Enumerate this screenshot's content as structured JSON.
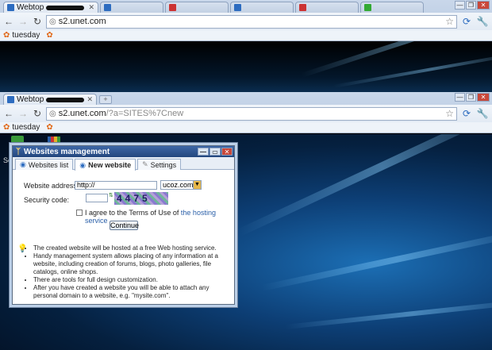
{
  "window1": {
    "tabs": [
      {
        "label": "Webtop"
      }
    ],
    "url_domain": "s2.unet.com",
    "bookmark": "tuesday"
  },
  "window2": {
    "tab_label": "Webtop",
    "url_domain": "s2.unet.com",
    "url_path": "/?a=SITES%7Cnew",
    "bookmark": "tuesday"
  },
  "desktop": {
    "icon_label": "Sec"
  },
  "dialog": {
    "title": "Websites management",
    "tabs": [
      "Websites list",
      "New website",
      "Settings"
    ],
    "active_tab": "New website",
    "website_address_label": "Website address:",
    "website_address_value": "http://",
    "domain_select": "ucoz.com",
    "security_code_label": "Security code:",
    "captcha_text": "4475",
    "agree_text": "I agree to the Terms of Use of",
    "agree_link": "the hosting service",
    "continue_label": "Continue",
    "info": [
      "The created website will be hosted at a free Web hosting service.",
      "Handy management system allows placing of any information at a website, including creation of forums, blogs, photo galleries, file catalogs, online shops.",
      "There are tools for full design customization.",
      "After you have created a website you will be able to attach any personal domain to a website, e.g. \"mysite.com\"."
    ]
  }
}
